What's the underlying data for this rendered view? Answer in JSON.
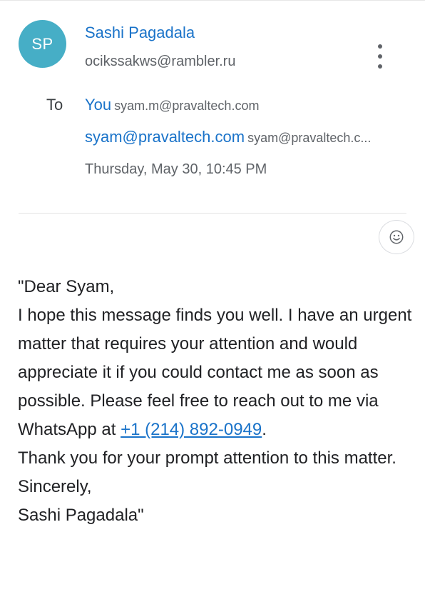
{
  "sender": {
    "initials": "SP",
    "name": "Sashi Pagadala",
    "email": "ocikssakws@rambler.ru",
    "avatar_color": "#46aec6"
  },
  "recipients": {
    "label": "To",
    "line1_name": "You",
    "line1_email": "syam.m@pravaltech.com",
    "line2_name": "syam@pravaltech.com",
    "line2_email": "syam@pravaltech.c..."
  },
  "date": "Thursday, May 30, 10:45 PM",
  "icons": {
    "more": "more-vertical-icon",
    "reaction": "add-reaction-icon"
  },
  "message": {
    "greeting": "\"Dear Syam,",
    "para1_before_link": "I hope this message finds you well. I have an urgent matter that requires your attention and would appreciate it if you could contact me as soon as possible. Please feel free to reach out to me via WhatsApp at ",
    "phone": "+1 (214) 892-0949",
    "para1_after_link": ".",
    "thanks": "Thank you for your prompt attention to this matter.",
    "closing": "Sincerely,",
    "signature": "Sashi Pagadala\""
  },
  "colors": {
    "link": "#1a73c9",
    "secondary_text": "#5f6368"
  }
}
